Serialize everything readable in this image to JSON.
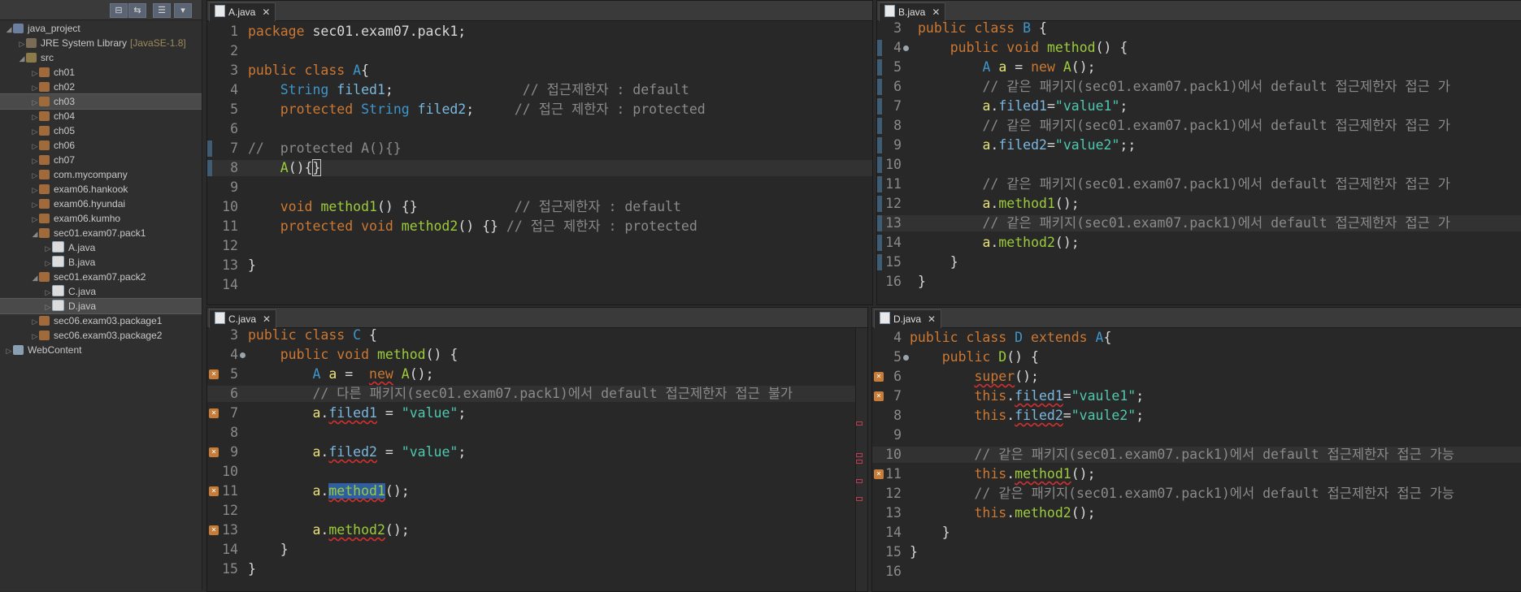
{
  "explorer": {
    "items": [
      {
        "label": "java_project",
        "indent": 0,
        "arrow": "◢",
        "icon": "proj"
      },
      {
        "label": "JRE System Library",
        "extra": "[JavaSE-1.8]",
        "indent": 1,
        "arrow": "▷",
        "icon": "lib"
      },
      {
        "label": "src",
        "indent": 1,
        "arrow": "◢",
        "icon": "src"
      },
      {
        "label": "ch01",
        "indent": 2,
        "arrow": "▷",
        "icon": "pkg"
      },
      {
        "label": "ch02",
        "indent": 2,
        "arrow": "▷",
        "icon": "pkg"
      },
      {
        "label": "ch03",
        "indent": 2,
        "arrow": "▷",
        "icon": "pkg",
        "selected": true
      },
      {
        "label": "ch04",
        "indent": 2,
        "arrow": "▷",
        "icon": "pkg"
      },
      {
        "label": "ch05",
        "indent": 2,
        "arrow": "▷",
        "icon": "pkg"
      },
      {
        "label": "ch06",
        "indent": 2,
        "arrow": "▷",
        "icon": "pkg"
      },
      {
        "label": "ch07",
        "indent": 2,
        "arrow": "▷",
        "icon": "pkg"
      },
      {
        "label": "com.mycompany",
        "indent": 2,
        "arrow": "▷",
        "icon": "pkg"
      },
      {
        "label": "exam06.hankook",
        "indent": 2,
        "arrow": "▷",
        "icon": "pkg"
      },
      {
        "label": "exam06.hyundai",
        "indent": 2,
        "arrow": "▷",
        "icon": "pkg"
      },
      {
        "label": "exam06.kumho",
        "indent": 2,
        "arrow": "▷",
        "icon": "pkg"
      },
      {
        "label": "sec01.exam07.pack1",
        "indent": 2,
        "arrow": "◢",
        "icon": "pkg"
      },
      {
        "label": "A.java",
        "indent": 3,
        "arrow": "▷",
        "icon": "java"
      },
      {
        "label": "B.java",
        "indent": 3,
        "arrow": "▷",
        "icon": "java"
      },
      {
        "label": "sec01.exam07.pack2",
        "indent": 2,
        "arrow": "◢",
        "icon": "pkg"
      },
      {
        "label": "C.java",
        "indent": 3,
        "arrow": "▷",
        "icon": "java"
      },
      {
        "label": "D.java",
        "indent": 3,
        "arrow": "▷",
        "icon": "java",
        "selected": true
      },
      {
        "label": "sec06.exam03.package1",
        "indent": 2,
        "arrow": "▷",
        "icon": "pkg"
      },
      {
        "label": "sec06.exam03.package2",
        "indent": 2,
        "arrow": "▷",
        "icon": "pkg"
      },
      {
        "label": "WebContent",
        "indent": 0,
        "arrow": "▷",
        "icon": "web"
      }
    ]
  },
  "editors": [
    {
      "id": "a",
      "tab": "A.java",
      "lines": [
        {
          "n": "1",
          "t": [
            [
              "kw",
              "package"
            ],
            [
              "",
              "sec01.exam07.pack1;"
            ]
          ]
        },
        {
          "n": "2",
          "t": []
        },
        {
          "n": "3",
          "t": [
            [
              "kw",
              "public class"
            ],
            [
              "",
              "A",
              "ty"
            ],
            [
              "",
              "{"
            ]
          ]
        },
        {
          "n": "4",
          "t": [
            [
              "",
              "    "
            ],
            [
              "ty",
              "String"
            ],
            [
              "",
              ""
            ],
            [
              "fld",
              "filed1"
            ],
            [
              "",
              ";"
            ],
            [
              "",
              "                "
            ],
            [
              "cm",
              "// 접근제한자 : default"
            ]
          ]
        },
        {
          "n": "5",
          "t": [
            [
              "",
              "    "
            ],
            [
              "kw",
              "protected"
            ],
            [
              "",
              ""
            ],
            [
              "ty",
              "String"
            ],
            [
              "",
              ""
            ],
            [
              "fld",
              "filed2"
            ],
            [
              "",
              ";"
            ],
            [
              "",
              "     "
            ],
            [
              "cm",
              "// 접근 제한자 : protected"
            ]
          ]
        },
        {
          "n": "6",
          "t": []
        },
        {
          "n": "7",
          "t": [
            [
              "cm",
              "//  protected A(){}"
            ]
          ]
        },
        {
          "n": "8",
          "t": [
            [
              "",
              "    "
            ],
            [
              "fn",
              "A"
            ],
            [
              "",
              "(){"
            ],
            [
              "cursor",
              "}"
            ]
          ]
        },
        {
          "n": "9",
          "t": []
        },
        {
          "n": "10",
          "t": [
            [
              "",
              "    "
            ],
            [
              "kw",
              "void"
            ],
            [
              "",
              ""
            ],
            [
              "fn",
              "method1"
            ],
            [
              "",
              "() {}"
            ],
            [
              "",
              "            "
            ],
            [
              "cm",
              "// 접근제한자 : default"
            ]
          ]
        },
        {
          "n": "11",
          "t": [
            [
              "",
              "    "
            ],
            [
              "kw",
              "protected void"
            ],
            [
              "",
              ""
            ],
            [
              "fn",
              "method2"
            ],
            [
              "",
              "() {} "
            ],
            [
              "cm",
              "// 접근 제한자 : protected"
            ]
          ]
        },
        {
          "n": "12",
          "t": []
        },
        {
          "n": "13",
          "t": [
            [
              "",
              "}"
            ]
          ]
        },
        {
          "n": "14",
          "t": []
        }
      ]
    },
    {
      "id": "b",
      "tab": "B.java",
      "lines": [
        {
          "n": "3",
          "t": [
            [
              "kw",
              "public class"
            ],
            [
              "",
              ""
            ],
            [
              "ty",
              "B"
            ],
            [
              "",
              " {"
            ]
          ]
        },
        {
          "n": "4",
          "t": [
            [
              "",
              "    "
            ],
            [
              "kw",
              "public void"
            ],
            [
              "",
              ""
            ],
            [
              "fn",
              "method"
            ],
            [
              "",
              "() {"
            ]
          ]
        },
        {
          "n": "5",
          "t": [
            [
              "",
              "        "
            ],
            [
              "ty",
              "A"
            ],
            [
              "",
              ""
            ],
            [
              "vr",
              "a"
            ],
            [
              "",
              " = "
            ],
            [
              "kw",
              "new"
            ],
            [
              "",
              ""
            ],
            [
              "fn",
              "A"
            ],
            [
              "",
              "();"
            ]
          ]
        },
        {
          "n": "6",
          "t": [
            [
              "",
              "        "
            ],
            [
              "cm",
              "// 같은 패키지(sec01.exam07.pack1)에서 default 접근제한자 접근 가"
            ]
          ]
        },
        {
          "n": "7",
          "t": [
            [
              "",
              "        "
            ],
            [
              "vr",
              "a"
            ],
            [
              "",
              "."
            ],
            [
              "fld",
              "filed1"
            ],
            [
              "",
              "="
            ],
            [
              "str",
              "\"value1\""
            ],
            [
              "",
              ";"
            ]
          ]
        },
        {
          "n": "8",
          "t": [
            [
              "",
              "        "
            ],
            [
              "cm",
              "// 같은 패키지(sec01.exam07.pack1)에서 default 접근제한자 접근 가"
            ]
          ]
        },
        {
          "n": "9",
          "t": [
            [
              "",
              "        "
            ],
            [
              "vr",
              "a"
            ],
            [
              "",
              "."
            ],
            [
              "fld",
              "filed2"
            ],
            [
              "",
              "="
            ],
            [
              "str",
              "\"value2\""
            ],
            [
              "",
              ";;"
            ]
          ]
        },
        {
          "n": "10",
          "t": []
        },
        {
          "n": "11",
          "t": [
            [
              "",
              "        "
            ],
            [
              "cm",
              "// 같은 패키지(sec01.exam07.pack1)에서 default 접근제한자 접근 가"
            ]
          ]
        },
        {
          "n": "12",
          "t": [
            [
              "",
              "        "
            ],
            [
              "vr",
              "a"
            ],
            [
              "",
              "."
            ],
            [
              "fn",
              "method1"
            ],
            [
              "",
              "();"
            ]
          ]
        },
        {
          "n": "13",
          "t": [
            [
              "",
              "        "
            ],
            [
              "cm",
              "// 같은 패키지(sec01.exam07.pack1)에서 default 접근제한자 접근 가"
            ]
          ]
        },
        {
          "n": "14",
          "t": [
            [
              "",
              "        "
            ],
            [
              "vr",
              "a"
            ],
            [
              "",
              "."
            ],
            [
              "fn",
              "method2"
            ],
            [
              "",
              "();"
            ]
          ]
        },
        {
          "n": "15",
          "t": [
            [
              "",
              "    }"
            ]
          ]
        },
        {
          "n": "16",
          "t": [
            [
              "",
              "}"
            ]
          ]
        }
      ]
    },
    {
      "id": "c",
      "tab": "C.java",
      "lines": [
        {
          "n": "3",
          "t": [
            [
              "kw",
              "public class"
            ],
            [
              "",
              ""
            ],
            [
              "ty",
              "C"
            ],
            [
              "",
              " {"
            ]
          ]
        },
        {
          "n": "4",
          "t": [
            [
              "",
              "    "
            ],
            [
              "kw",
              "public void"
            ],
            [
              "",
              ""
            ],
            [
              "fn",
              "method"
            ],
            [
              "",
              "() {"
            ]
          ]
        },
        {
          "n": "5",
          "t": [
            [
              "",
              "        "
            ],
            [
              "ty",
              "A"
            ],
            [
              "",
              ""
            ],
            [
              "vr",
              "a"
            ],
            [
              "",
              " =  "
            ],
            [
              "kw sq",
              "new"
            ],
            [
              "",
              ""
            ],
            [
              "fn",
              "A"
            ],
            [
              "",
              "();"
            ]
          ]
        },
        {
          "n": "6",
          "t": [
            [
              "",
              "        "
            ],
            [
              "cm",
              "// 다른 패키지(sec01.exam07.pack1)에서 default 접근제한자 접근 불가"
            ]
          ]
        },
        {
          "n": "7",
          "t": [
            [
              "",
              "        "
            ],
            [
              "vr",
              "a"
            ],
            [
              "",
              "."
            ],
            [
              "fld sq",
              "filed1"
            ],
            [
              "",
              " = "
            ],
            [
              "str",
              "\"value\""
            ],
            [
              "",
              ";"
            ]
          ]
        },
        {
          "n": "8",
          "t": []
        },
        {
          "n": "9",
          "t": [
            [
              "",
              "        "
            ],
            [
              "vr",
              "a"
            ],
            [
              "",
              "."
            ],
            [
              "fld sq",
              "filed2"
            ],
            [
              "",
              " = "
            ],
            [
              "str",
              "\"value\""
            ],
            [
              "",
              ";"
            ]
          ]
        },
        {
          "n": "10",
          "t": []
        },
        {
          "n": "11",
          "t": [
            [
              "",
              "        "
            ],
            [
              "vr",
              "a"
            ],
            [
              "",
              "."
            ],
            [
              "fn sel-word sq",
              "method1"
            ],
            [
              "",
              "();"
            ]
          ]
        },
        {
          "n": "12",
          "t": []
        },
        {
          "n": "13",
          "t": [
            [
              "",
              "        "
            ],
            [
              "vr",
              "a"
            ],
            [
              "",
              "."
            ],
            [
              "fn sq",
              "method2"
            ],
            [
              "",
              "();"
            ]
          ]
        },
        {
          "n": "14",
          "t": [
            [
              "",
              "    }"
            ]
          ]
        },
        {
          "n": "15",
          "t": [
            [
              "",
              "}"
            ]
          ]
        }
      ]
    },
    {
      "id": "d",
      "tab": "D.java",
      "lines": [
        {
          "n": "4",
          "t": [
            [
              "kw",
              "public class"
            ],
            [
              "",
              ""
            ],
            [
              "ty",
              "D"
            ],
            [
              "",
              ""
            ],
            [
              "kw",
              "extends"
            ],
            [
              "",
              ""
            ],
            [
              "ty",
              "A"
            ],
            [
              "",
              "{"
            ]
          ]
        },
        {
          "n": "5",
          "t": [
            [
              "",
              "    "
            ],
            [
              "kw",
              "public"
            ],
            [
              "",
              ""
            ],
            [
              "fn",
              "D"
            ],
            [
              "",
              "() {"
            ]
          ]
        },
        {
          "n": "6",
          "t": [
            [
              "",
              "        "
            ],
            [
              "kw sq",
              "super"
            ],
            [
              "",
              "();"
            ]
          ]
        },
        {
          "n": "7",
          "t": [
            [
              "",
              "        "
            ],
            [
              "kw",
              "this"
            ],
            [
              "",
              "."
            ],
            [
              "fld sq",
              "filed1"
            ],
            [
              "",
              "="
            ],
            [
              "str",
              "\"vaule1\""
            ],
            [
              "",
              ";"
            ]
          ]
        },
        {
          "n": "8",
          "t": [
            [
              "",
              "        "
            ],
            [
              "kw",
              "this"
            ],
            [
              "",
              "."
            ],
            [
              "fld sq",
              "filed2"
            ],
            [
              "",
              "="
            ],
            [
              "str",
              "\"vaule2\""
            ],
            [
              "",
              ";"
            ]
          ]
        },
        {
          "n": "9",
          "t": []
        },
        {
          "n": "10",
          "t": [
            [
              "",
              "        "
            ],
            [
              "cm",
              "// 같은 패키지(sec01.exam07.pack1)에서 default 접근제한자 접근 가능"
            ]
          ]
        },
        {
          "n": "11",
          "t": [
            [
              "",
              "        "
            ],
            [
              "kw",
              "this"
            ],
            [
              "",
              "."
            ],
            [
              "fn sq",
              "method1"
            ],
            [
              "",
              "();"
            ]
          ]
        },
        {
          "n": "12",
          "t": [
            [
              "",
              "        "
            ],
            [
              "cm",
              "// 같은 패키지(sec01.exam07.pack1)에서 default 접근제한자 접근 가능"
            ]
          ]
        },
        {
          "n": "13",
          "t": [
            [
              "",
              "        "
            ],
            [
              "kw",
              "this"
            ],
            [
              "",
              "."
            ],
            [
              "fn",
              "method2"
            ],
            [
              "",
              "();"
            ]
          ]
        },
        {
          "n": "14",
          "t": [
            [
              "",
              "    }"
            ]
          ]
        },
        {
          "n": "15",
          "t": [
            [
              "",
              "}"
            ]
          ]
        },
        {
          "n": "16",
          "t": []
        }
      ]
    }
  ]
}
